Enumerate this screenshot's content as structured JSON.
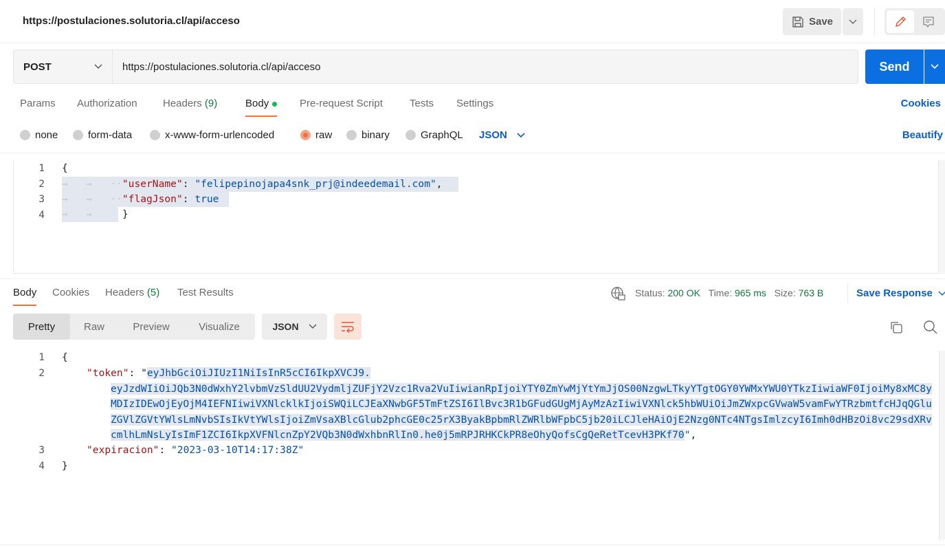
{
  "header": {
    "title": "https://postulaciones.solutoria.cl/api/acceso",
    "save_label": "Save"
  },
  "request": {
    "method": "POST",
    "url": "https://postulaciones.solutoria.cl/api/acceso",
    "send_label": "Send",
    "tabs": [
      {
        "label": "Params"
      },
      {
        "label": "Authorization"
      },
      {
        "label": "Headers",
        "count": "(9)"
      },
      {
        "label": "Body"
      },
      {
        "label": "Pre-request Script"
      },
      {
        "label": "Tests"
      },
      {
        "label": "Settings"
      }
    ],
    "cookies_label": "Cookies",
    "body_types": [
      "none",
      "form-data",
      "x-www-form-urlencoded",
      "raw",
      "binary",
      "GraphQL"
    ],
    "selected_body_type": "raw",
    "language": "JSON",
    "beautify_label": "Beautify",
    "body_lines": {
      "line_numbers": [
        "1",
        "2",
        "3",
        "4"
      ],
      "open": "{",
      "k1": "\"userName\"",
      "v1": "\"felipepinojapa4snk_prj@indeedemail.com\"",
      "k2": "\"flagJson\"",
      "v2": "true",
      "close": "}"
    }
  },
  "response": {
    "tabs": [
      {
        "label": "Body"
      },
      {
        "label": "Cookies"
      },
      {
        "label": "Headers",
        "count": "(5)"
      },
      {
        "label": "Test Results"
      }
    ],
    "status_label": "Status:",
    "status": "200 OK",
    "time_label": "Time:",
    "time": "965 ms",
    "size_label": "Size:",
    "size": "763 B",
    "save_response_label": "Save Response",
    "views": [
      "Pretty",
      "Raw",
      "Preview",
      "Visualize"
    ],
    "format": "JSON",
    "line_numbers": [
      "1",
      "2",
      "3",
      "4"
    ],
    "open": "{",
    "token_key": "\"token\"",
    "token_value": "eyJhbGciOiJIUzI1NiIsInR5cCI6IkpXVCJ9.eyJzdWIiOiJQb3N0dWxhY2lvbmVzSldUU2VydmljZUFjY2Vzc1Rva2VuIiwianRpIjoiYTY0ZmYwMjYtYmJjOS00NzgwLTkyYTgtOGY0YWMxYWU0YTkzIiwiaWF0IjoiMy8xMC8yMDIzIDEwOjEyOjM4IEFNIiwiVXNlcklkIjoiSWQiLCJEaXNwbGF5TmFtZSI6IlBvc3R1bGFudGUgMjAyMzAzIiwiVXNlck5hbWUiOiJmZWxpcGVwaW5vamFwYTRzbmtfcHJqQGluZGVlZGVtYWlsLmNvbSIsIkVtYWlsIjoiZmVsaXBlcGlub2phcGE0c25rX3ByakBpbmRlZWRlbWFpbC5jb20iLCJleHAiOjE2Nzg0NTc4NTgsImlzcyI6Imh0dHBzOi8vc29sdXRvcmlhLmNsLyIsImF1ZCI6IkpXVFNlcnZpY2VQb3N0dWxhbnRlIn0.he0j5mRPJRHKCkPR8eOhyQofsCgQeRetTcevH3PKf70",
    "exp_key": "\"expiracion\"",
    "exp_value": "\"2023-03-10T14:17:38Z\"",
    "close": "}"
  },
  "colors": {
    "accent": "#ff6c37",
    "send": "#0c6fe1",
    "link": "#0c5fc4",
    "success": "#0f7b3b"
  }
}
